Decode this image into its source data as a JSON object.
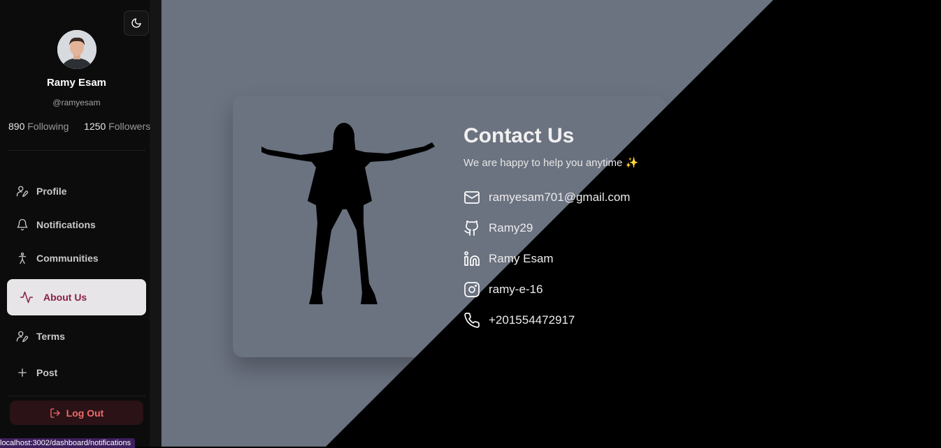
{
  "sidebar": {
    "profile": {
      "name": "Ramy Esam",
      "handle": "@ramyesam",
      "following_count": "890",
      "following_label": "Following",
      "followers_count": "1250",
      "followers_label": "Followers"
    },
    "theme_toggle_icon": "moon-icon",
    "items": [
      {
        "label": "Profile",
        "icon": "user-edit-icon"
      },
      {
        "label": "Notifications",
        "icon": "bell-icon"
      },
      {
        "label": "Communities",
        "icon": "person-icon"
      },
      {
        "label": "About Us",
        "icon": "activity-icon",
        "active": true
      },
      {
        "label": "Terms",
        "icon": "user-edit-icon"
      },
      {
        "label": "Post",
        "icon": "plus-icon"
      }
    ],
    "logout_label": "Log Out",
    "status_url": "localhost:3002/dashboard/notifications"
  },
  "contact": {
    "title": "Contact Us",
    "subtitle": "We are happy to help you anytime ✨",
    "rows": [
      {
        "icon": "mail-icon",
        "value": "ramyesam701@gmail.com"
      },
      {
        "icon": "github-icon",
        "value": "Ramy29"
      },
      {
        "icon": "linkedin-icon",
        "value": "Ramy Esam"
      },
      {
        "icon": "instagram-icon",
        "value": "ramy-e-16"
      },
      {
        "icon": "phone-icon",
        "value": "+201554472917"
      }
    ]
  },
  "colors": {
    "main_background": "#6b7280",
    "sidebar": "#0c0c0c",
    "active_item_bg": "#e7e5e8",
    "active_item_text": "#8a1f47",
    "logout_text": "#f06a6a"
  }
}
